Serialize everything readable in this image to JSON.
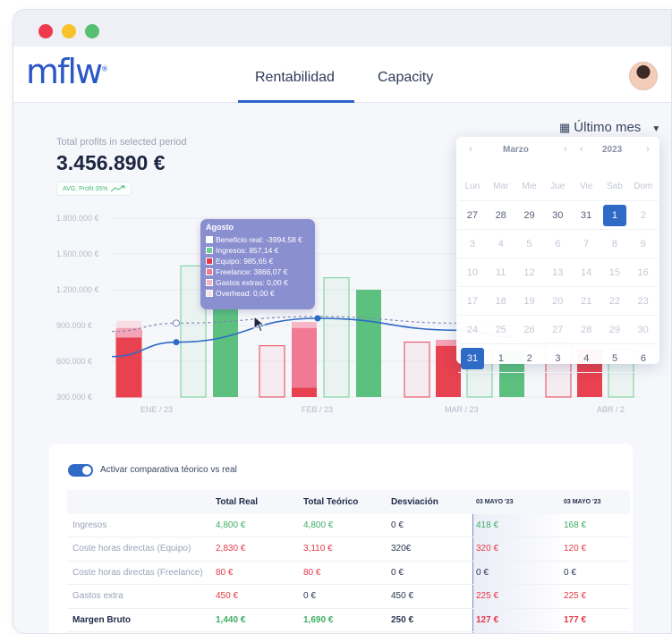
{
  "app": {
    "logo": "mflw",
    "logo_mark": "®",
    "tabs": [
      {
        "label": "Rentabilidad",
        "active": true
      },
      {
        "label": "Capacity",
        "active": false
      }
    ]
  },
  "summary": {
    "caption": "Total profits in selected period",
    "total": "3.456.890 €",
    "avg_badge": "AVG. Profit 35%"
  },
  "range_selector": {
    "label": "Último mes",
    "icon": "calendar-icon"
  },
  "calendar": {
    "month": "Marzo",
    "year": "2023",
    "weekdays": [
      "Lun",
      "Mar",
      "Mie",
      "Jue",
      "Vie",
      "Sab",
      "Dom"
    ],
    "weeks": [
      [
        "27",
        "28",
        "29",
        "30",
        "31",
        "1",
        "2"
      ],
      [
        "3",
        "4",
        "5",
        "6",
        "7",
        "8",
        "9"
      ],
      [
        "10",
        "11",
        "12",
        "13",
        "14",
        "15",
        "16"
      ],
      [
        "17",
        "18",
        "19",
        "20",
        "21",
        "22",
        "23"
      ],
      [
        "24",
        "25",
        "26",
        "27",
        "28",
        "29",
        "30"
      ],
      [
        "31",
        "1",
        "2",
        "3",
        "4",
        "5",
        "6"
      ]
    ],
    "selected_start": "1",
    "selected_end": "31"
  },
  "tooltip": {
    "title": "Agosto",
    "rows": [
      {
        "label": "Beneficio real: -3994,58 €",
        "color": "#ffffff"
      },
      {
        "label": "Ingresos: 857,14 €",
        "color": "#6fcf8f"
      },
      {
        "label": "Equipo: 985,65 €",
        "color": "#e23a49"
      },
      {
        "label": "Freelance: 3866,07 €",
        "color": "#f07a8f"
      },
      {
        "label": "Gastos extras: 0,00 €",
        "color": "#f3b6c6"
      },
      {
        "label": "Overhead: 0,00 €",
        "color": "#f4e4ea"
      }
    ]
  },
  "chart_data": {
    "type": "bar",
    "y_ticks": [
      "1.800.000 €",
      "1.500.000 €",
      "1.200.000 €",
      "900.000 €",
      "600.000 €",
      "300.000 €"
    ],
    "ylim": [
      300000,
      1800000
    ],
    "x_labels": [
      "ENE / 23",
      "FEB / 23",
      "MAR / 23",
      "ABR / 2"
    ],
    "groups": [
      {
        "month": "ENE / 23",
        "real_outline": 860000,
        "real_stack": [
          {
            "v": 800000,
            "c": "#e8414f"
          },
          {
            "v": 80000,
            "c": "#f5a3b7"
          },
          {
            "v": 60000,
            "c": "#f9dde5"
          }
        ],
        "income_outline": 1400000,
        "income_fill": null
      },
      {
        "month": "ENE / 23 b",
        "real_outline": 0,
        "real_stack": [],
        "income_outline": 0,
        "income_fill": 1260000
      },
      {
        "month": "FEB / 23",
        "real_outline": 730000,
        "real_stack": [
          {
            "v": 400000,
            "c": "#e8414f"
          },
          {
            "v": 820000,
            "c": "#f07a93"
          },
          {
            "v": 50000,
            "c": "#f5b6c6"
          }
        ],
        "income_outline": 1300000,
        "income_fill": 1200000
      },
      {
        "month": "MAR / 23",
        "real_outline": 760000,
        "real_stack": [
          {
            "v": 730000,
            "c": "#e8414f"
          },
          {
            "v": 50000,
            "c": "#f5a3b7"
          }
        ],
        "income_outline": 0,
        "income_fill": 0
      }
    ],
    "line_real": [
      620000,
      760000,
      960000,
      820000
    ],
    "line_teorico": [
      860000,
      920000,
      970000,
      900000
    ]
  },
  "table": {
    "toggle_label": "Activar comparativa téorico vs real",
    "headers": [
      "",
      "Total Real",
      "Total Teórico",
      "Desviación",
      "03 MAYO '23",
      "03 MAYO '23"
    ],
    "rows": [
      {
        "label": "Ingresos",
        "cells": [
          {
            "v": "4,800 €",
            "c": "green"
          },
          {
            "v": "4,800 €",
            "c": "green"
          },
          {
            "v": "0 €",
            "c": "dark"
          },
          {
            "v": "418 €",
            "c": "green"
          },
          {
            "v": "168 €",
            "c": "green"
          }
        ]
      },
      {
        "label": "Coste horas directas (Equipo)",
        "cells": [
          {
            "v": "2,830 €",
            "c": "red"
          },
          {
            "v": "3,110 €",
            "c": "red"
          },
          {
            "v": "320€",
            "c": "red"
          },
          {
            "v": "320 €",
            "c": "red"
          },
          {
            "v": "120 €",
            "c": "red"
          }
        ]
      },
      {
        "label": "Coste horas directas (Freelance)",
        "cells": [
          {
            "v": "80 €",
            "c": "red"
          },
          {
            "v": "80 €",
            "c": "red"
          },
          {
            "v": "0 €",
            "c": "dark"
          },
          {
            "v": "0 €",
            "c": "dark"
          },
          {
            "v": "0 €",
            "c": "dark"
          }
        ]
      },
      {
        "label": "Gastos extra",
        "cells": [
          {
            "v": "450 €",
            "c": "red"
          },
          {
            "v": "0 €",
            "c": "dark"
          },
          {
            "v": "450 €",
            "c": "red"
          },
          {
            "v": "225 €",
            "c": "red"
          },
          {
            "v": "225 €",
            "c": "red"
          }
        ]
      },
      {
        "label": "Margen Bruto",
        "bold": true,
        "cells": [
          {
            "v": "1,440 €",
            "c": "green"
          },
          {
            "v": "1,690 €",
            "c": "green"
          },
          {
            "v": "250 €",
            "c": "green"
          },
          {
            "v": "127 €",
            "c": "red"
          },
          {
            "v": "177 €",
            "c": "red"
          }
        ]
      }
    ]
  }
}
